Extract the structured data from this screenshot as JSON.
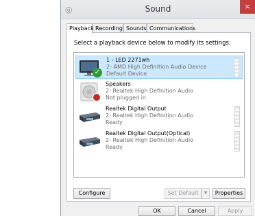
{
  "window": {
    "title": "Sound",
    "close_label": "×"
  },
  "tabs": [
    {
      "label": "Playback"
    },
    {
      "label": "Recording"
    },
    {
      "label": "Sounds"
    },
    {
      "label": "Communications"
    }
  ],
  "instruction": "Select a playback device below to modify its settings:",
  "devices": [
    {
      "name": "1 - LED 2271wh",
      "line2": "2- AMD High Definition Audio Device",
      "line3": "Default Device",
      "icon": "monitor-icon",
      "status": "default-check"
    },
    {
      "name": "Speakers",
      "line2": "2- Realtek High Definition Audio",
      "line3": "Not plugged in",
      "icon": "speaker-icon",
      "status": "unplugged"
    },
    {
      "name": "Realtek Digital Output",
      "line2": "2- Realtek High Definition Audio",
      "line3": "Ready",
      "icon": "digital-output-icon"
    },
    {
      "name": "Realtek Digital Output(Optical)",
      "line2": "2- Realtek High Definition Audio",
      "line3": "Ready",
      "icon": "optical-output-icon"
    }
  ],
  "buttons": {
    "configure": "Configure",
    "set_default": "Set Default",
    "set_default_arrow": "▼",
    "properties": "Properties",
    "ok": "OK",
    "cancel": "Cancel",
    "apply": "Apply"
  },
  "colors": {
    "selected_bg": "#cce8ff",
    "close_bg": "#c73c3c",
    "check_green": "#2e9b3a",
    "unplugged_red": "#c62828"
  }
}
